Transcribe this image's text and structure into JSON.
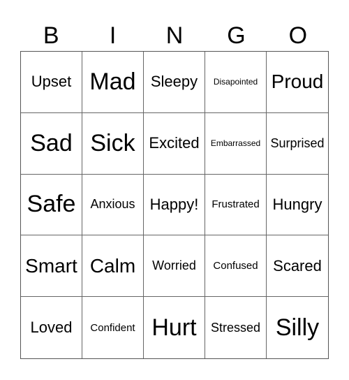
{
  "header": [
    "B",
    "I",
    "N",
    "G",
    "O"
  ],
  "cells": [
    {
      "text": "Upset",
      "size": "m"
    },
    {
      "text": "Mad",
      "size": "xl"
    },
    {
      "text": "Sleepy",
      "size": "m"
    },
    {
      "text": "Disapointed",
      "size": "xxs"
    },
    {
      "text": "Proud",
      "size": "l"
    },
    {
      "text": "Sad",
      "size": "xl"
    },
    {
      "text": "Sick",
      "size": "xl"
    },
    {
      "text": "Excited",
      "size": "m"
    },
    {
      "text": "Embarrassed",
      "size": "xxs"
    },
    {
      "text": "Surprised",
      "size": "sm"
    },
    {
      "text": "Safe",
      "size": "xl"
    },
    {
      "text": "Anxious",
      "size": "sm"
    },
    {
      "text": "Happy!",
      "size": "m"
    },
    {
      "text": "Frustrated",
      "size": "xs"
    },
    {
      "text": "Hungry",
      "size": "m"
    },
    {
      "text": "Smart",
      "size": "l"
    },
    {
      "text": "Calm",
      "size": "l"
    },
    {
      "text": "Worried",
      "size": "sm"
    },
    {
      "text": "Confused",
      "size": "xs"
    },
    {
      "text": "Scared",
      "size": "m"
    },
    {
      "text": "Loved",
      "size": "m"
    },
    {
      "text": "Confident",
      "size": "xs"
    },
    {
      "text": "Hurt",
      "size": "xl"
    },
    {
      "text": "Stressed",
      "size": "sm"
    },
    {
      "text": "Silly",
      "size": "xl"
    }
  ]
}
